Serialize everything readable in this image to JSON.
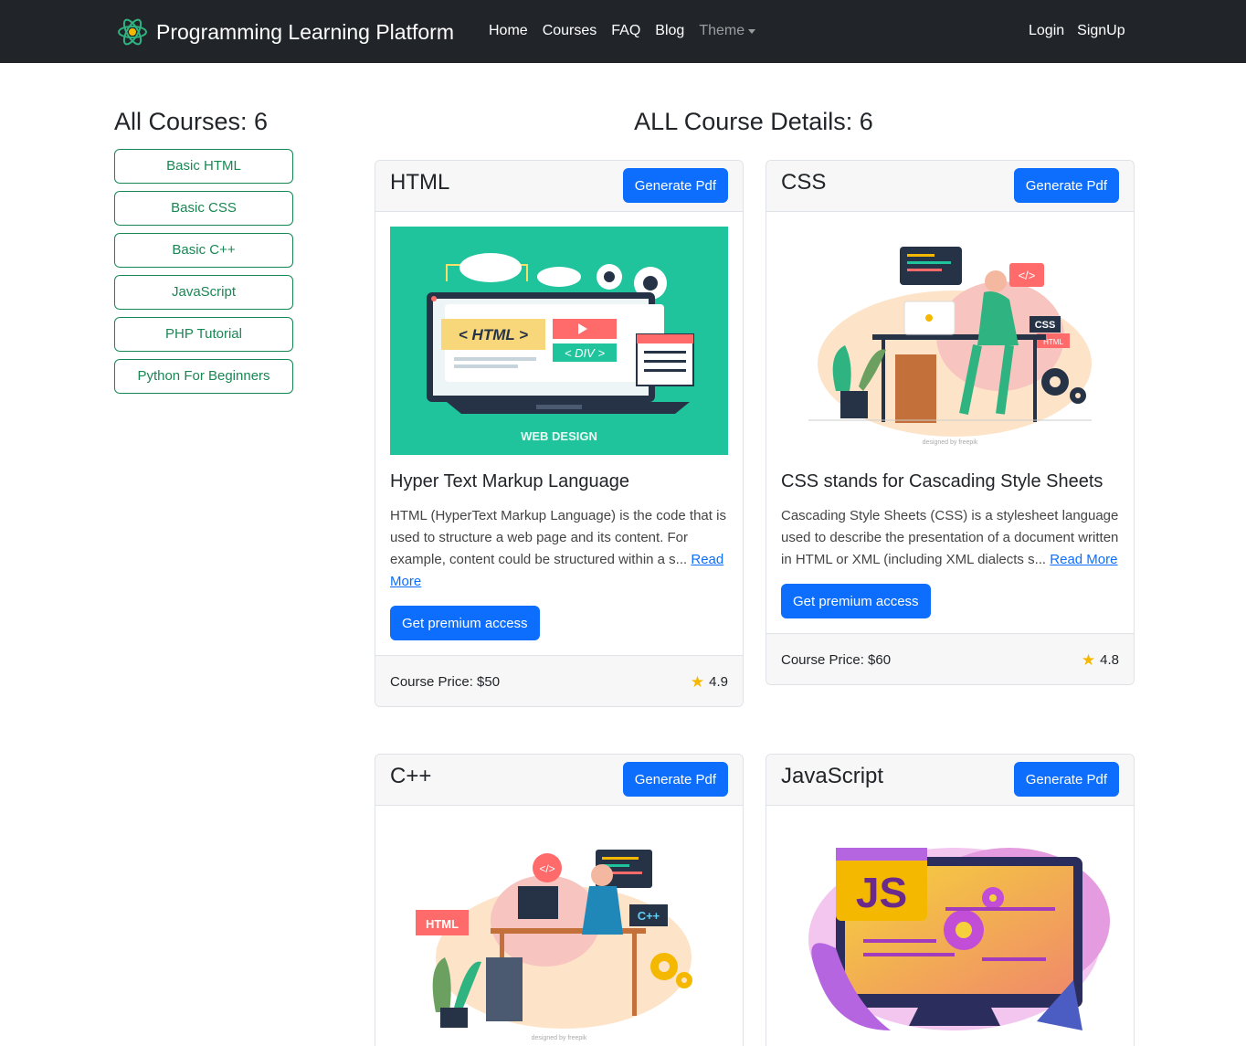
{
  "navbar": {
    "brand": "Programming Learning Platform",
    "links": [
      "Home",
      "Courses",
      "FAQ",
      "Blog"
    ],
    "theme": "Theme",
    "login": "Login",
    "signup": "SignUp"
  },
  "sidebar": {
    "title": "All Courses: 6",
    "courses": [
      "Basic HTML",
      "Basic CSS",
      "Basic C++",
      "JavaScript",
      "PHP Tutorial",
      "Python For Beginners"
    ]
  },
  "main": {
    "title": "ALL Course Details: 6",
    "pdf_label": "Generate Pdf",
    "cards": [
      {
        "name": "HTML",
        "image_caption": "WEB DESIGN",
        "image_tags": [
          "< HTML >",
          "< DIV >"
        ],
        "title": "Hyper Text Markup Language",
        "text": "HTML (HyperText Markup Language) is the code that is used to structure a web page and its content. For example, content could be structured within a s...",
        "read_more": "Read More",
        "premium": "Get premium access",
        "price": "Course Price: $50",
        "rating": "4.9"
      },
      {
        "name": "CSS",
        "image_tags": [
          "CSS",
          "HTML",
          "</>"
        ],
        "image_credit": "designed by freepik",
        "title": "CSS stands for Cascading Style Sheets",
        "text": "Cascading Style Sheets (CSS) is a stylesheet language used to describe the presentation of a document written in HTML or XML (including XML dialects s...",
        "read_more": "Read More",
        "premium": "Get premium access",
        "price": "Course Price: $60",
        "rating": "4.8"
      },
      {
        "name": "C++",
        "image_tags": [
          "HTML",
          "C++",
          "</>"
        ],
        "image_credit": "designed by freepik"
      },
      {
        "name": "JavaScript",
        "image_tags": [
          "JS"
        ]
      }
    ]
  },
  "colors": {
    "navbar": "#212529",
    "primary": "#0d6efd",
    "success": "#198754",
    "star": "#f5b800"
  }
}
